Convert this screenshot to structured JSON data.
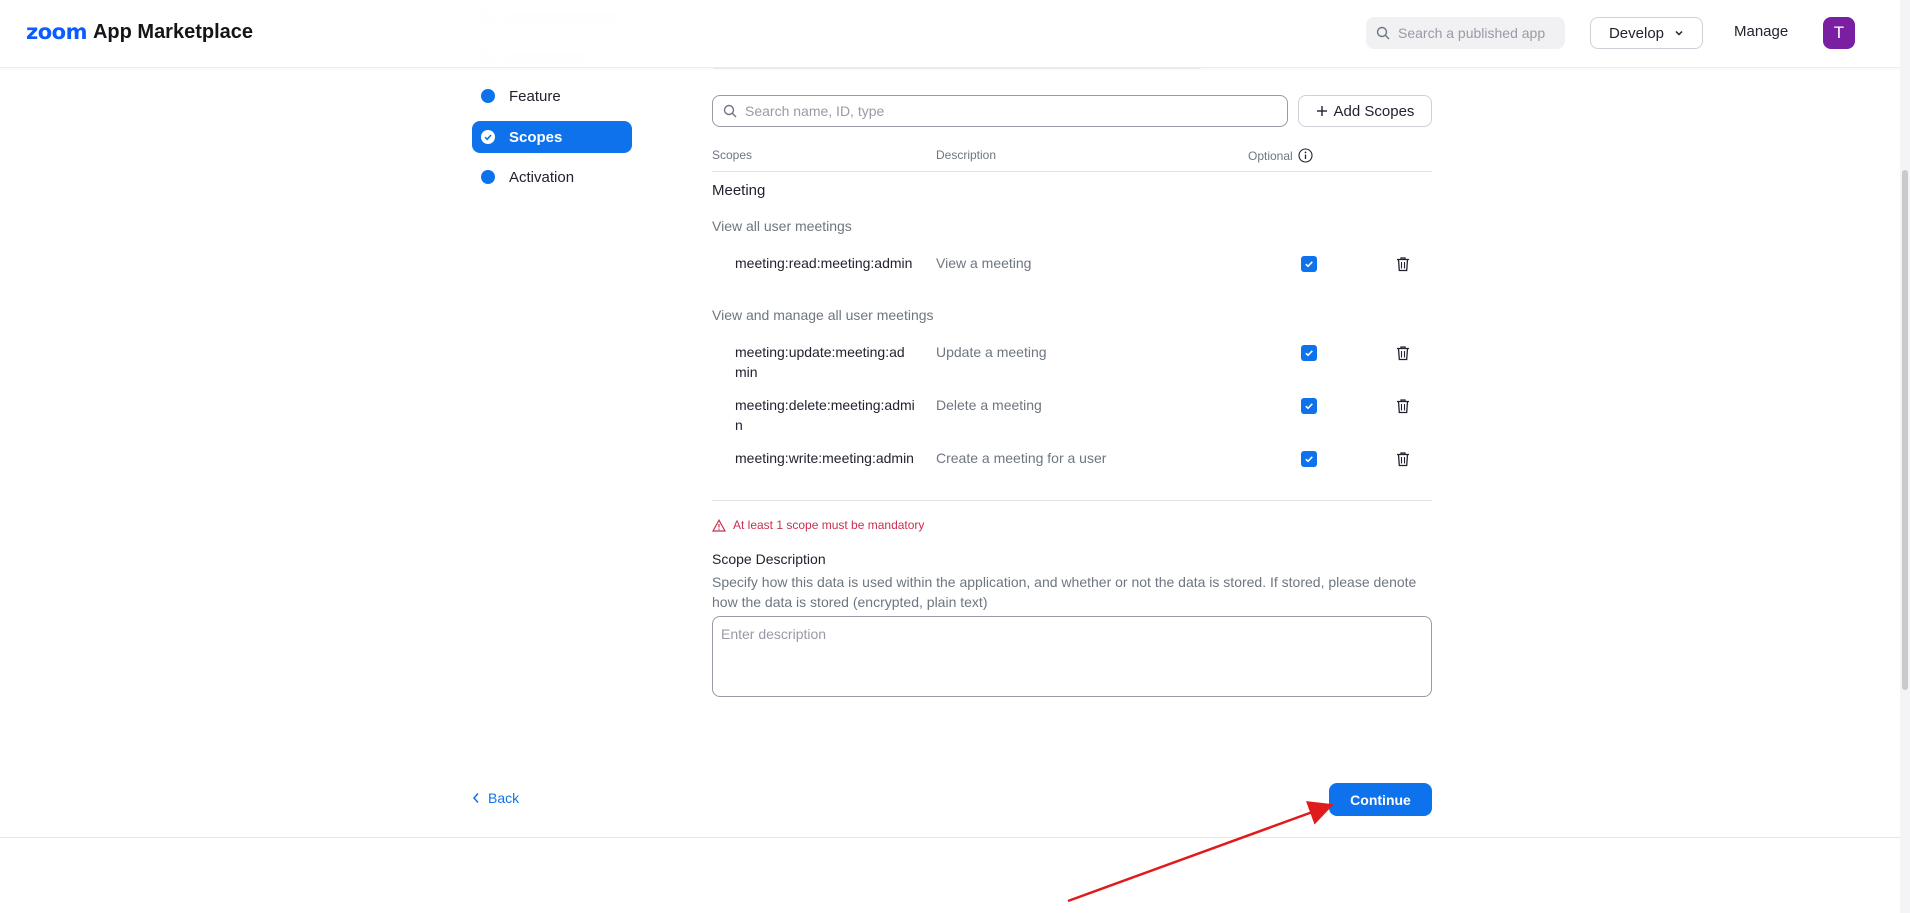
{
  "header": {
    "logo_zoom": "zoom",
    "logo_marketplace": "App Marketplace",
    "search_placeholder": "Search a published app",
    "develop_label": "Develop",
    "manage_label": "Manage",
    "avatar_initial": "T"
  },
  "nav": {
    "items": [
      {
        "label": "Feature",
        "active": false
      },
      {
        "label": "Scopes",
        "active": true
      },
      {
        "label": "Activation",
        "active": false
      }
    ]
  },
  "scopes": {
    "search_placeholder": "Search name, ID, type",
    "add_button": "Add Scopes",
    "columns": {
      "scopes": "Scopes",
      "description": "Description",
      "optional": "Optional"
    },
    "group": "Meeting",
    "subgroups": [
      {
        "title": "View all user meetings",
        "rows": [
          {
            "scope": "meeting:read:meeting:admin",
            "description": "View a meeting",
            "optional": true
          }
        ]
      },
      {
        "title": "View and manage all user meetings",
        "rows": [
          {
            "scope": "meeting:update:meeting:admin",
            "description": "Update a meeting",
            "optional": true
          },
          {
            "scope": "meeting:delete:meeting:admin",
            "description": "Delete a meeting",
            "optional": true
          },
          {
            "scope": "meeting:write:meeting:admin",
            "description": "Create a meeting for a user",
            "optional": true
          }
        ]
      }
    ],
    "error": "At least 1 scope must be mandatory",
    "description_title": "Scope Description",
    "description_help": "Specify how this data is used within the application, and whether or not the data is stored. If stored, please denote how the data is stored (encrypted, plain text)",
    "description_placeholder": "Enter description"
  },
  "footer": {
    "back_label": "Back",
    "continue_label": "Continue"
  },
  "colors": {
    "primary": "#0e72ed",
    "error": "#c8304f",
    "avatar": "#7a1fa2",
    "annotation_arrow": "#e01b1b"
  }
}
